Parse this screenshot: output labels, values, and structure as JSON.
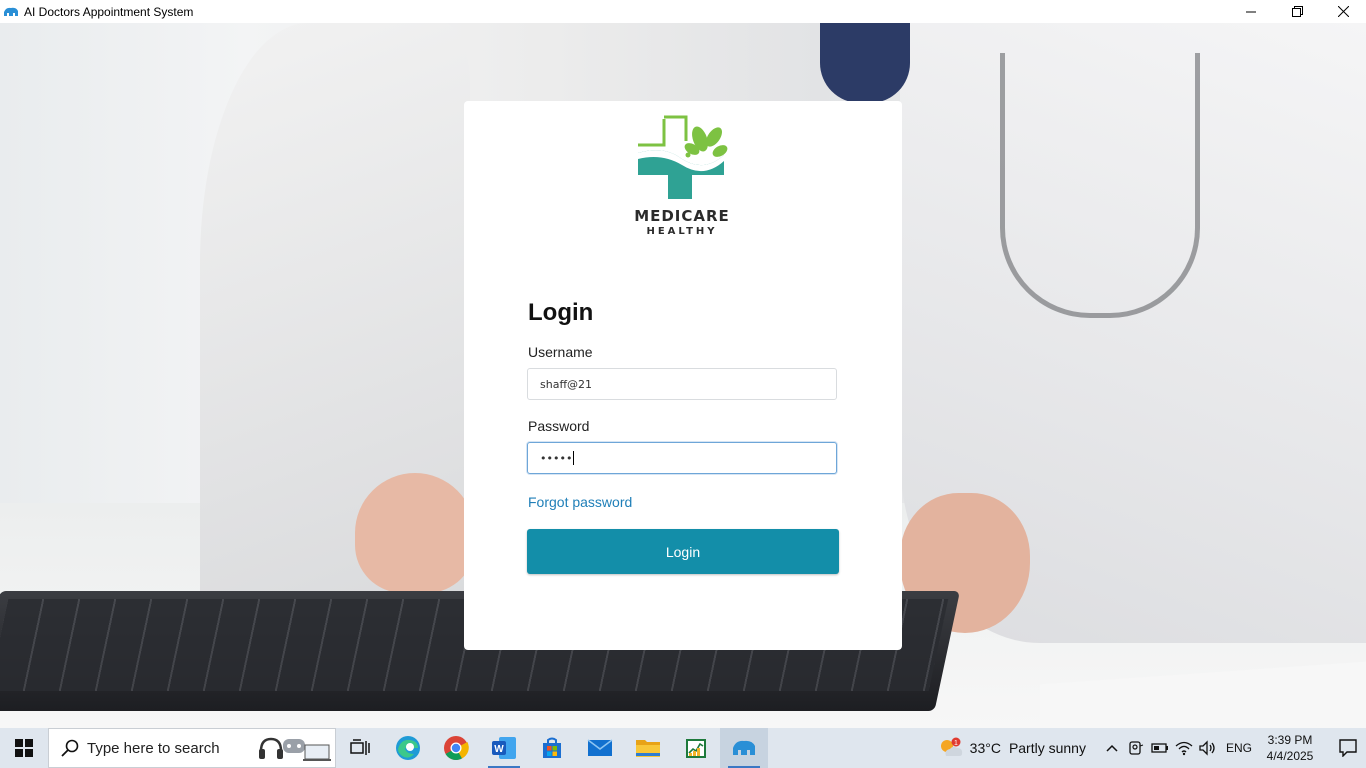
{
  "window": {
    "title": "AI Doctors Appointment System"
  },
  "logo": {
    "name": "MEDICARE",
    "subtitle": "HEALTHY"
  },
  "login": {
    "title": "Login",
    "username_label": "Username",
    "username_value": "shaff@21",
    "password_label": "Password",
    "password_masked": "•••••",
    "forgot_label": "Forgot password",
    "button_label": "Login"
  },
  "taskbar": {
    "search_placeholder": "Type here to search",
    "weather_temp": "33°C",
    "weather_desc": "Partly sunny",
    "weather_badge": "1",
    "language": "ENG",
    "time": "3:39 PM",
    "date": "4/4/2025"
  },
  "colors": {
    "accent": "#138ea9",
    "link": "#1f7fb8",
    "logo_teal": "#2fa294",
    "logo_green": "#7dc242"
  }
}
